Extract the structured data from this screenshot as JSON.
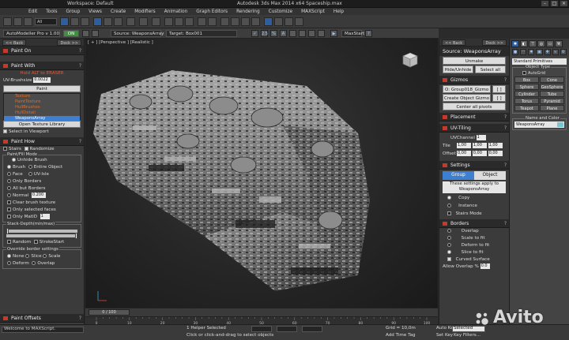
{
  "window": {
    "title": "Autodesk 3ds Max  2014 x64      Spaceship.max",
    "workspace": "Workspace: Default"
  },
  "menu": [
    "Edit",
    "Tools",
    "Group",
    "Views",
    "Create",
    "Modifiers",
    "Animation",
    "Graph Editors",
    "Rendering",
    "Customize",
    "MAXScript",
    "Help"
  ],
  "toolbar": {
    "selection_filter": "All"
  },
  "automodeller": {
    "name": "AutoModeller Pro v 1.00",
    "on_label": "ON",
    "source_label": "Source: WeaponsArray",
    "target_label": "Target: Box001",
    "maxstart_label": "MaxStart",
    "snap_labels": [
      "2.5",
      "%",
      "A"
    ]
  },
  "left_panel": {
    "nav_back": "<< Back",
    "nav_dock": "Dock >>",
    "paint_on": "Paint On",
    "paint_with": "Paint With",
    "hint": "Hold ALT to ERASER",
    "uv_brush_label": "UV-Brushsize",
    "uv_brush_value": "0.0022",
    "paint_button": "Paint",
    "textures": [
      "Texture",
      "PaintTexture",
      "HullBrushes",
      "HullDetail",
      "WeaponsArray"
    ],
    "selected_texture": "WeaponsArray",
    "open_library": "Open Texture Library",
    "select_in_viewport": "Select in Viewport",
    "paint_how": "Paint How",
    "stairs": "Stairs",
    "randomize": "Randomize",
    "paint_fill_mode": "Paint/Fill Mode",
    "unhide_brush": "Unhide Brush",
    "brush": "Brush",
    "entire_object": "Entire Object",
    "face": "Face",
    "uv_isle": "UV-Isle",
    "only_borders": "Only Borders",
    "all_but_borders": "All but Borders",
    "normal": "Normal",
    "normal_value": "0.200",
    "clear_brush_texture": "Clear brush texture",
    "only_selected_faces": "Only selected faces",
    "only_matid": "Only MatID",
    "matid_value": "1",
    "stack_depth": "Stack-Depth(min/max)",
    "random": "Random",
    "stroke_start": "StrokeStart",
    "override_border": "Override border settings",
    "none": "None",
    "slice": "Slice",
    "scale": "Scale",
    "deform": "Deform",
    "overlap": "Overlap",
    "paint_offsets": "Paint Offsets"
  },
  "viewport": {
    "label": "[ + ] [Perspective ] [Realistic ]"
  },
  "timeline": {
    "frame": "0 / 100",
    "ticks": [
      "0",
      "10",
      "20",
      "30",
      "40",
      "50",
      "60",
      "70",
      "80",
      "90",
      "100"
    ]
  },
  "statusbar": {
    "script": "Welcome to MAXScript.",
    "selected": "1 Helper Selected",
    "prompt": "Click or click-and-drag to select objects",
    "grid": "Grid = 10,0m",
    "add_time_tag": "Add Time Tag",
    "auto_key": "Auto Key",
    "selected_filter": "Selected",
    "set_key": "Set Key",
    "key_filters": "Key Filters..."
  },
  "right_panel": {
    "nav_back": "<< Back",
    "nav_dock": "Dock >>",
    "source": "Source: WeaponsArray",
    "unmake": "Unmake",
    "hide_unhide": "Hide/Unhide",
    "select_all": "Select all",
    "gizmos": "Gizmos",
    "gizmo_name": "O: Group018_Gizmo",
    "create_gizmo": "Create Object Gizmo",
    "center_pivots": "Center all pivots",
    "placement": "Placement",
    "uv_tiling": "UV-Tiling",
    "uv_channel_label": "UVChannel",
    "uv_channel_value": "1",
    "tile_label": "Tile",
    "tile_values": [
      "1,00",
      "1,00",
      "1,00"
    ],
    "offset_label": "Offset",
    "offset_values": [
      "0,00",
      "0,00",
      "0,00"
    ],
    "settings": "Settings",
    "tab_group": "Group",
    "tab_object": "Object",
    "apply_note": "These settings apply to WeaponsArray",
    "copy": "Copy",
    "instance": "Instance",
    "stairs_mode": "Stairs Mode",
    "borders": "Borders",
    "overlap": "Overlap",
    "scale_to_fit": "Scale to fit",
    "deform_to_fit": "Deform to fit",
    "slice_to_fit": "Slice to fit",
    "curved_surface": "Curved Surface",
    "allow_overlap": "Allow Overlap %",
    "allow_overlap_value": "0.0"
  },
  "command_panel": {
    "dropdown": "Standard Primitives",
    "object_type": "Object Type",
    "autogrid": "AutoGrid",
    "primitives": [
      "Box",
      "Cone",
      "Sphere",
      "GeoSphere",
      "Cylinder",
      "Tube",
      "Torus",
      "Pyramid",
      "Teapot",
      "Plane"
    ],
    "name_and_color": "Name and Color",
    "name_value": "WeaponsArray"
  },
  "watermark": {
    "text": "Avito"
  }
}
